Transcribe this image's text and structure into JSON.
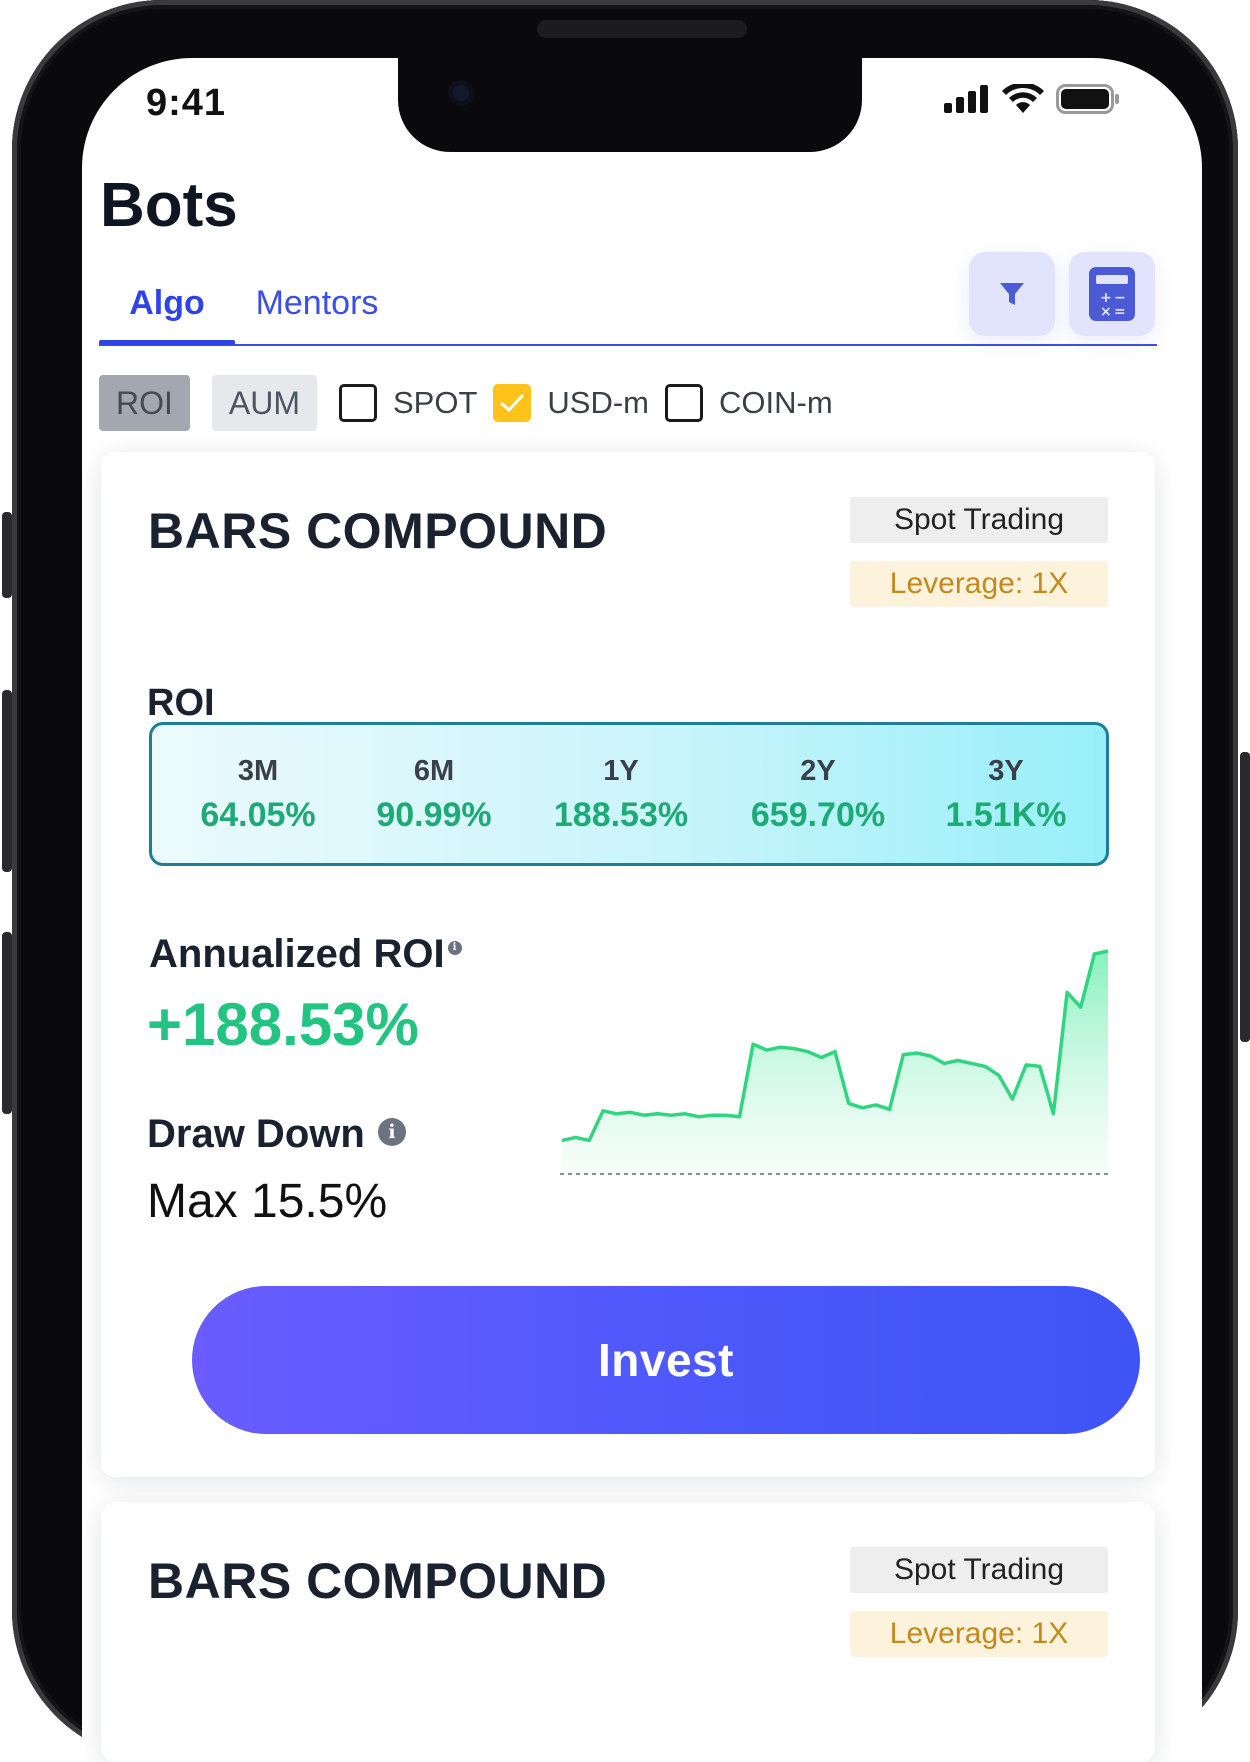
{
  "status_bar": {
    "time": "9:41"
  },
  "header": {
    "title": "Bots"
  },
  "tabs": [
    {
      "label": "Algo"
    },
    {
      "label": "Mentors"
    }
  ],
  "toolbar": {
    "filter_icon": "filter-icon",
    "calculator_icon": "calculator-icon"
  },
  "filters": {
    "sort_chips": [
      {
        "label": "ROI",
        "active": true
      },
      {
        "label": "AUM",
        "active": false
      }
    ],
    "checkboxes": [
      {
        "label": "SPOT",
        "checked": false
      },
      {
        "label": "USD-m",
        "checked": true
      },
      {
        "label": "COIN-m",
        "checked": false
      }
    ]
  },
  "cards": [
    {
      "name": "BARS COMPOUND",
      "type_tag": "Spot Trading",
      "leverage_tag": "Leverage: 1X",
      "roi_label": "ROI",
      "roi": [
        {
          "period": "3M",
          "value": "64.05%"
        },
        {
          "period": "6M",
          "value": "90.99%"
        },
        {
          "period": "1Y",
          "value": "188.53%"
        },
        {
          "period": "2Y",
          "value": "659.70%"
        },
        {
          "period": "3Y",
          "value": "1.51K%"
        }
      ],
      "annualized_label": "Annualized ROI",
      "annualized_value": "+188.53%",
      "drawdown_label": "Draw Down",
      "drawdown_value": "Max 15.5%",
      "invest_label": "Invest",
      "sparkline": [
        20,
        22,
        20,
        40,
        38,
        39,
        37,
        38,
        37,
        38,
        36,
        37,
        37,
        36,
        85,
        81,
        83,
        82,
        80,
        76,
        80,
        45,
        42,
        44,
        41,
        78,
        79,
        77,
        72,
        74,
        72,
        70,
        64,
        48,
        71,
        70,
        38,
        120,
        110,
        146,
        148
      ],
      "colors": {
        "roi_value": "#1daa74",
        "annualized": "#23c482",
        "accent": "#3f54f5"
      }
    },
    {
      "name": "BARS COMPOUND",
      "type_tag": "Spot Trading",
      "leverage_tag": "Leverage: 1X"
    }
  ]
}
